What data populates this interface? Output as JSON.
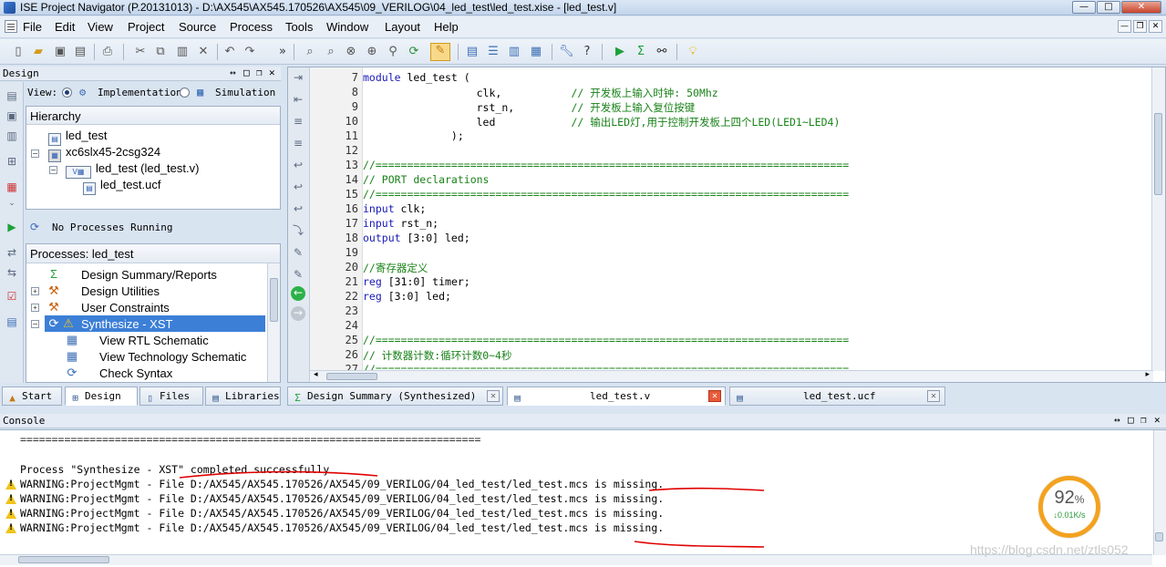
{
  "window": {
    "title": "ISE Project Navigator (P.20131013) - D:\\AX545\\AX545.170526\\AX545\\09_VERILOG\\04_led_test\\led_test.xise - [led_test.v]",
    "min": "—",
    "max": "□",
    "close": "✕"
  },
  "menu": [
    "File",
    "Edit",
    "View",
    "Project",
    "Source",
    "Process",
    "Tools",
    "Window",
    "Layout",
    "Help"
  ],
  "design_panel": {
    "title": "Design",
    "view_label": "View:",
    "implementation": "Implementation",
    "simulation": "Simulation",
    "hierarchy_header": "Hierarchy",
    "hierarchy": [
      "led_test",
      "xc6slx45-2csg324",
      "led_test (led_test.v)",
      "led_test.ucf"
    ],
    "status": "No Processes Running",
    "processes_header": "Processes: led_test",
    "processes": [
      "Design Summary/Reports",
      "Design Utilities",
      "User Constraints",
      "Synthesize - XST",
      "View RTL Schematic",
      "View Technology Schematic",
      "Check Syntax"
    ]
  },
  "editor": {
    "line_numbers": [
      "7",
      "8",
      "9",
      "10",
      "11",
      "12",
      "13",
      "14",
      "15",
      "16",
      "17",
      "18",
      "19",
      "20",
      "21",
      "22",
      "23",
      "24",
      "25",
      "26",
      "27"
    ],
    "lines": [
      [
        [
          "kw",
          "module"
        ],
        [
          "t",
          " led_test ("
        ]
      ],
      [
        [
          "t",
          "                  clk,           "
        ],
        [
          "cm",
          "// 开发板上输入时钟: 50Mhz"
        ]
      ],
      [
        [
          "t",
          "                  rst_n,         "
        ],
        [
          "cm",
          "// 开发板上输入复位按键"
        ]
      ],
      [
        [
          "t",
          "                  led            "
        ],
        [
          "cm",
          "// 输出LED灯,用于控制开发板上四个LED(LED1~LED4)"
        ]
      ],
      [
        [
          "t",
          "              );"
        ]
      ],
      [
        [
          "t",
          ""
        ]
      ],
      [
        [
          "cm",
          "//==========================================================================="
        ]
      ],
      [
        [
          "cm",
          "// PORT declarations"
        ]
      ],
      [
        [
          "cm",
          "//==========================================================================="
        ]
      ],
      [
        [
          "kw",
          "input"
        ],
        [
          "t",
          " clk;"
        ]
      ],
      [
        [
          "kw",
          "input"
        ],
        [
          "t",
          " rst_n;"
        ]
      ],
      [
        [
          "kw",
          "output"
        ],
        [
          "t",
          " [3:0] led;"
        ]
      ],
      [
        [
          "t",
          ""
        ]
      ],
      [
        [
          "cm",
          "//寄存器定义"
        ]
      ],
      [
        [
          "kw",
          "reg"
        ],
        [
          "t",
          " [31:0] timer;"
        ]
      ],
      [
        [
          "kw",
          "reg"
        ],
        [
          "t",
          " [3:0] led;"
        ]
      ],
      [
        [
          "t",
          ""
        ]
      ],
      [
        [
          "t",
          ""
        ]
      ],
      [
        [
          "cm",
          "//==========================================================================="
        ]
      ],
      [
        [
          "cm",
          "// 计数器计数:循环计数0~4秒"
        ]
      ],
      [
        [
          "cm",
          "//==========================================================================="
        ]
      ]
    ]
  },
  "tabs_left": [
    "Start",
    "Design",
    "Files",
    "Libraries"
  ],
  "tabs_editor": [
    "Design Summary (Synthesized)",
    "led_test.v",
    "led_test.ucf"
  ],
  "console": {
    "title": "Console",
    "rule": "=========================================================================",
    "success": "Process \"Synthesize - XST\" completed successfully",
    "warnings": [
      "WARNING:ProjectMgmt - File D:/AX545/AX545.170526/AX545/09_VERILOG/04_led_test/led_test.mcs is missing.",
      "WARNING:ProjectMgmt - File D:/AX545/AX545.170526/AX545/09_VERILOG/04_led_test/led_test.mcs is missing.",
      "WARNING:ProjectMgmt - File D:/AX545/AX545.170526/AX545/09_VERILOG/04_led_test/led_test.mcs is missing.",
      "WARNING:ProjectMgmt - File D:/AX545/AX545.170526/AX545/09_VERILOG/04_led_test/led_test.mcs is missing."
    ]
  },
  "overlay": {
    "percent": "92",
    "percent_sign": "%",
    "speed": "0.01K/s",
    "watermark": "https://blog.csdn.net/ztls052"
  },
  "colors": {
    "keyword": "#1a1ab8",
    "comment": "#198219",
    "selection": "#3c7fd6",
    "annotation": "#e00000"
  }
}
